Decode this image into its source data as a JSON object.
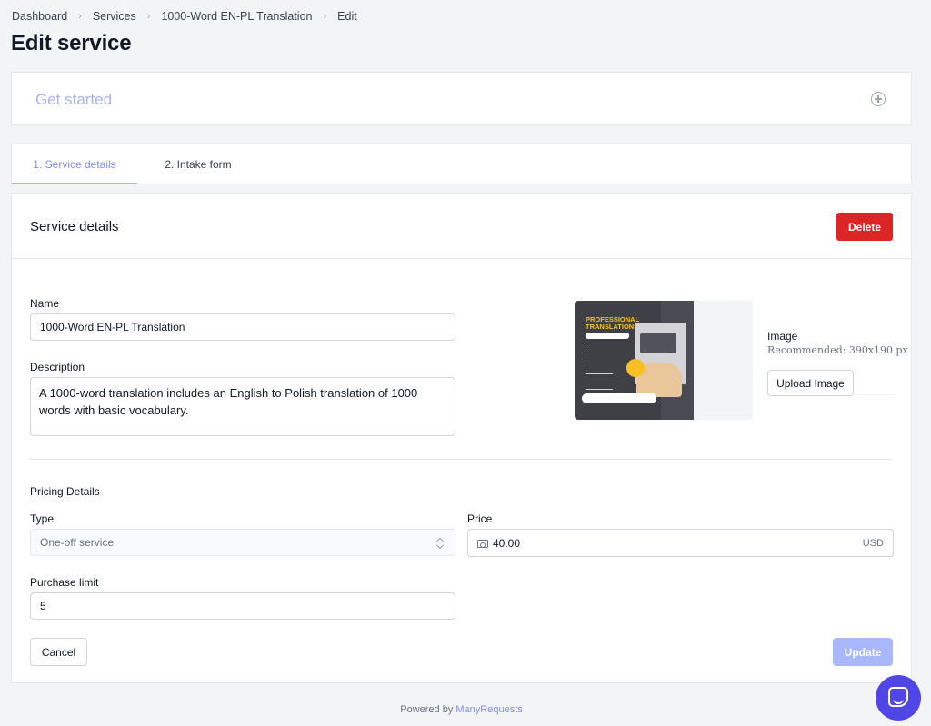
{
  "breadcrumb": [
    "Dashboard",
    "Services",
    "1000-Word EN-PL Translation",
    "Edit"
  ],
  "page": {
    "title": "Edit service"
  },
  "get_started": {
    "label": "Get started"
  },
  "tabs": [
    {
      "label": "1. Service details",
      "active": true
    },
    {
      "label": "2. Intake form",
      "active": false
    }
  ],
  "service_details": {
    "header": "Service details",
    "delete_label": "Delete",
    "name_label": "Name",
    "name_value": "1000-Word EN-PL Translation",
    "description_label": "Description",
    "description_value": "A 1000-word translation includes an English to Polish translation of 1000 words with basic vocabulary.",
    "image": {
      "label": "Image",
      "recommendation": "Recommended: 390x190 px",
      "upload_label": "Upload Image",
      "thumbnail_title": "PROFESSIONAL TRANSLATIONS"
    }
  },
  "pricing": {
    "section_label": "Pricing Details",
    "type_label": "Type",
    "type_value": "One-off service",
    "price_label": "Price",
    "price_value": "40.00",
    "currency": "USD",
    "purchase_limit_label": "Purchase limit",
    "purchase_limit_value": "5"
  },
  "actions": {
    "cancel_label": "Cancel",
    "update_label": "Update"
  },
  "footer": {
    "powered_by": "Powered by",
    "brand": "ManyRequests"
  },
  "colors": {
    "accent": "#818cf8",
    "danger": "#dc2626",
    "chat": "#4f46e5"
  }
}
